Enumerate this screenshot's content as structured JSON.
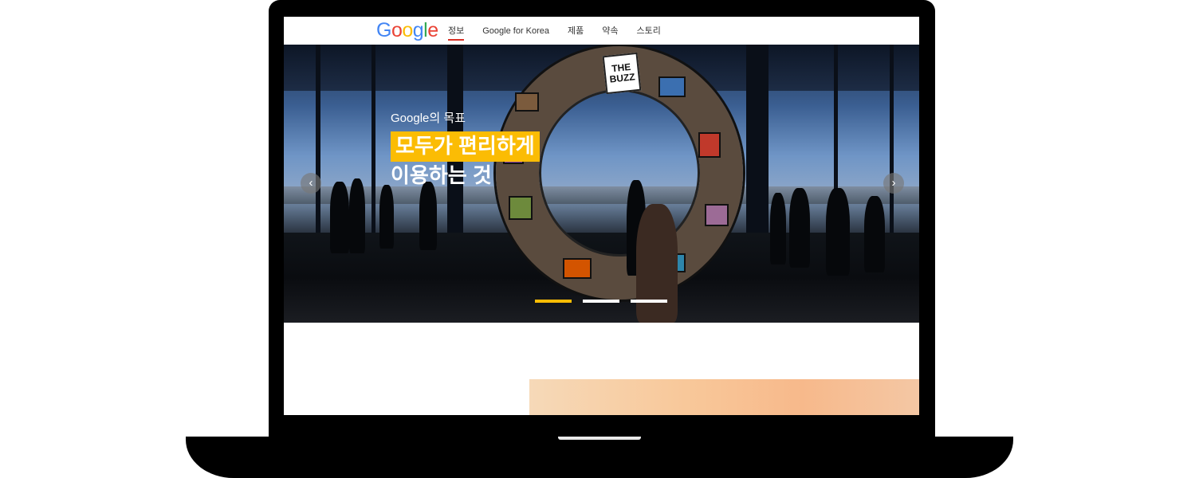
{
  "header": {
    "logo": [
      "G",
      "o",
      "o",
      "g",
      "l",
      "e"
    ],
    "logo_colors": [
      "#4285f4",
      "#ea4335",
      "#fbbc05",
      "#4285f4",
      "#34a853",
      "#ea4335"
    ],
    "nav": [
      {
        "label": "정보",
        "active": true
      },
      {
        "label": "Google for Korea",
        "active": false
      },
      {
        "label": "제품",
        "active": false
      },
      {
        "label": "약속",
        "active": false
      },
      {
        "label": "스토리",
        "active": false
      }
    ]
  },
  "hero": {
    "eyebrow": "Google의 목표",
    "headline_highlight": "모두가 편리하게",
    "headline_second": "이용하는 것",
    "ring_sign": "THE BUZZ",
    "prev_icon": "chevron-left-icon",
    "next_icon": "chevron-right-icon",
    "slides_total": 3,
    "active_slide": 1,
    "accent_color": "#fbbc04"
  }
}
